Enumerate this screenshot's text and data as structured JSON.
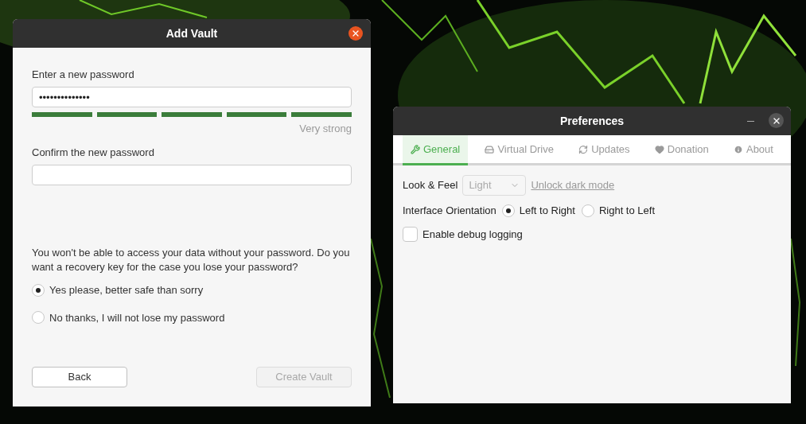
{
  "add_vault": {
    "title": "Add Vault",
    "password": {
      "label": "Enter a new password",
      "value": "••••••••••••••",
      "strength": {
        "level": 1,
        "text": "Very strong"
      }
    },
    "confirm": {
      "label": "Confirm the new password"
    },
    "recovery_question": "You won't be able to access your data without your password. Do you want a recovery key for the case you lose your password?",
    "recovery_options": [
      {
        "label": "Yes please, better safe than sorry",
        "selected": true
      },
      {
        "label": "No thanks, I will not lose my password",
        "selected": false
      }
    ],
    "buttons": [
      {
        "label": "Back",
        "disabled": false
      },
      {
        "label": "Create Vault",
        "disabled": true
      }
    ]
  },
  "preferences": {
    "title": "Preferences",
    "tabs": [
      {
        "label": "General",
        "selected": true
      },
      {
        "label": "Virtual Drive",
        "selected": false
      },
      {
        "label": "Updates",
        "selected": false
      },
      {
        "label": "Donation",
        "selected": false
      },
      {
        "label": "About",
        "selected": false
      }
    ],
    "look_and_feel": {
      "label": "Look & Feel",
      "value": "Light",
      "disabled": true,
      "link": "Unlock dark mode"
    },
    "orientation": {
      "label": "Interface Orientation",
      "options": [
        {
          "label": "Left to Right",
          "selected": true
        },
        {
          "label": "Right to Left",
          "selected": false
        }
      ]
    },
    "debug_logging": {
      "label": "Enable debug logging",
      "checked": false
    }
  }
}
